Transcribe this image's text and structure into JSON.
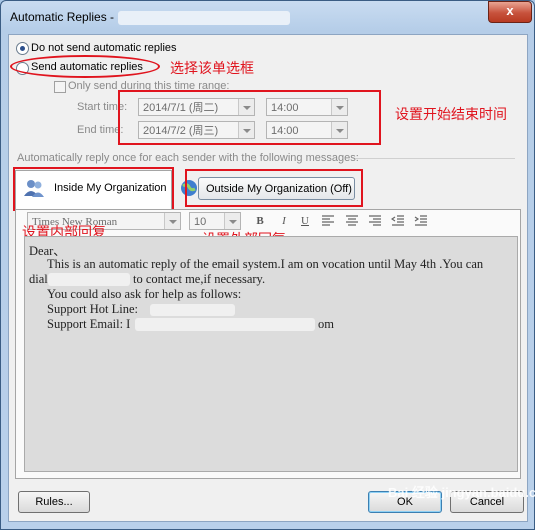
{
  "window": {
    "title": "Automatic Replies -",
    "close_glyph": "x"
  },
  "options": {
    "do_not_send": "Do not send automatic replies",
    "send": "Send automatic replies",
    "only_send_range": "Only send during this time range:",
    "start_time_label": "Start time:",
    "end_time_label": "End time:",
    "start_date": "2014/7/1 (周二)",
    "start_time": "14:00",
    "end_date": "2014/7/2 (周三)",
    "end_time": "14:00"
  },
  "section_label": "Automatically reply once for each sender with the following messages:",
  "tabs": {
    "inside": "Inside My Organization",
    "outside": "Outside My Organization (Off)"
  },
  "format": {
    "font": "Times New Roman",
    "size": "10"
  },
  "editor": {
    "line1": "Dear、",
    "line2": "This is an automatic reply of the email system.I am on vocation until May 4th .You can",
    "line3a": "dial",
    "line3b": "to contact me,if necessary.",
    "line4": "You could also ask for help as follows:",
    "line5": "Support Hot Line:",
    "line6a": "Support Email: I",
    "line6b": "om"
  },
  "buttons": {
    "rules": "Rules...",
    "ok": "OK",
    "cancel": "Cancel"
  },
  "annotations": {
    "select_radio": "选择该单选框",
    "set_time": "设置开始结束时间",
    "set_inside": "设置内部回复",
    "set_outside": "设置外部回复"
  },
  "watermark": "Bai 经验 jingyan.baidu.com"
}
